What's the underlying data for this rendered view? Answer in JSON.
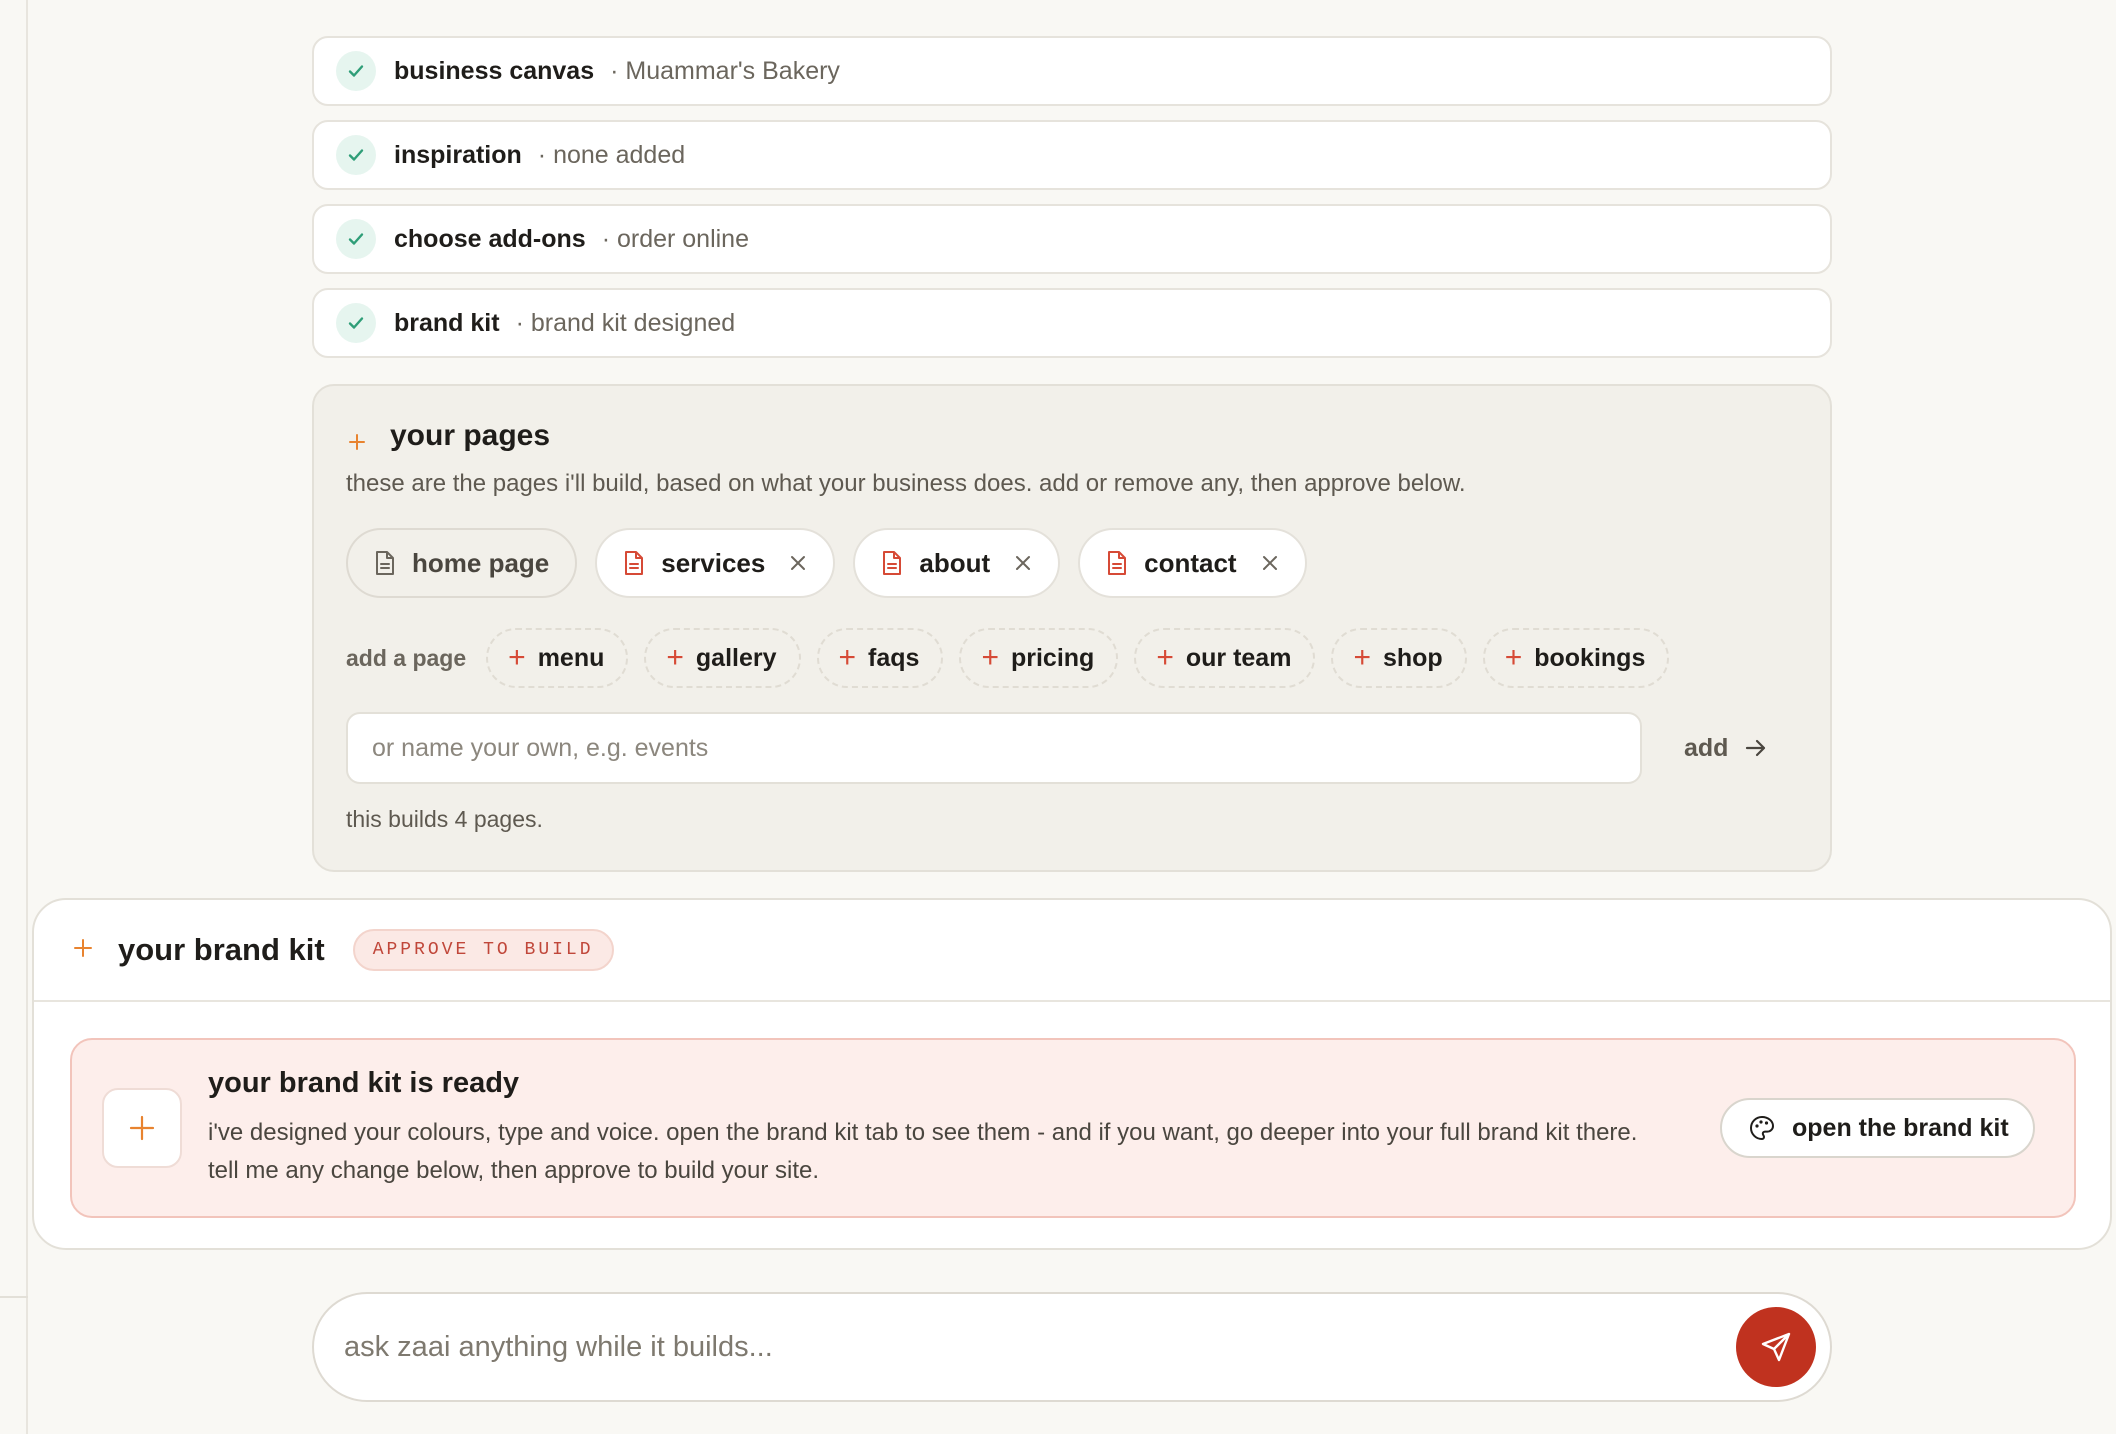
{
  "steps": [
    {
      "title": "business canvas",
      "sub": "· Muammar's Bakery"
    },
    {
      "title": "inspiration",
      "sub": "· none added"
    },
    {
      "title": "choose add-ons",
      "sub": "· order online"
    },
    {
      "title": "brand kit",
      "sub": "· brand kit designed"
    }
  ],
  "pages": {
    "title": "your pages",
    "description": "these are the pages i'll build, based on what your business does. add or remove any, then approve below.",
    "selected": [
      "home page",
      "services",
      "about",
      "contact"
    ],
    "add_label": "add a page",
    "suggestions": [
      "menu",
      "gallery",
      "faqs",
      "pricing",
      "our team",
      "shop",
      "bookings"
    ],
    "input_placeholder": "or name your own, e.g. events",
    "add_button": "add",
    "builds_note": "this builds 4 pages."
  },
  "brand_kit": {
    "title": "your brand kit",
    "badge": "APPROVE TO BUILD",
    "ready_title": "your brand kit is ready",
    "ready_body": "i've designed your colours, type and voice. open the brand kit tab to see them - and if you want, go deeper into your full brand kit there. tell me any change below, then approve to build your site.",
    "open_button": "open the brand kit"
  },
  "chat": {
    "placeholder": "ask zaai anything while it builds..."
  },
  "colors": {
    "accent": "#c0321f",
    "sparkle": "#e8832f",
    "check": "#2f9e78",
    "doc_icon": "#d64a36"
  }
}
